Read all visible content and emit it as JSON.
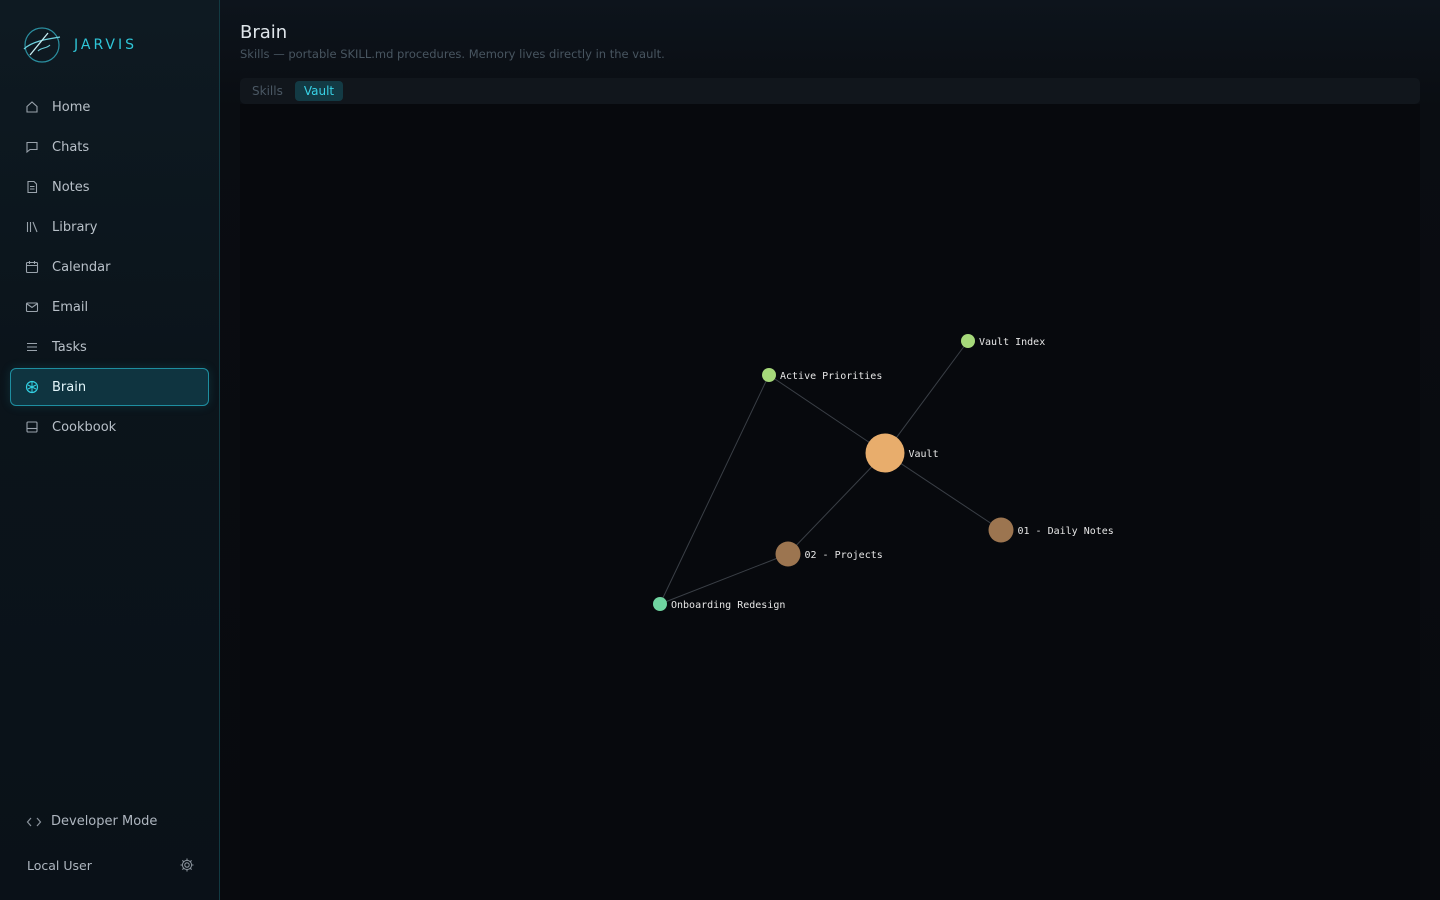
{
  "app": {
    "name": "JARVIS"
  },
  "sidebar": {
    "items": [
      {
        "label": "Home",
        "icon": "home-icon"
      },
      {
        "label": "Chats",
        "icon": "chat-icon"
      },
      {
        "label": "Notes",
        "icon": "note-icon"
      },
      {
        "label": "Library",
        "icon": "library-icon"
      },
      {
        "label": "Calendar",
        "icon": "calendar-icon"
      },
      {
        "label": "Email",
        "icon": "mail-icon"
      },
      {
        "label": "Tasks",
        "icon": "list-icon"
      },
      {
        "label": "Brain",
        "icon": "brain-icon",
        "active": true
      },
      {
        "label": "Cookbook",
        "icon": "book-icon"
      }
    ],
    "developer_mode": "Developer Mode",
    "user": "Local User"
  },
  "header": {
    "title": "Brain",
    "subtitle": "Skills — portable SKILL.md procedures. Memory lives directly in the vault."
  },
  "tabs": [
    {
      "label": "Skills",
      "active": false
    },
    {
      "label": "Vault",
      "active": true
    }
  ],
  "graph": {
    "nodes": [
      {
        "id": "vault",
        "label": "Vault",
        "color": "#e8ad6c",
        "size": "large"
      },
      {
        "id": "index",
        "label": "Vault Index",
        "color": "#a6d97a",
        "size": "small"
      },
      {
        "id": "active",
        "label": "Active Priorities",
        "color": "#a6d97a",
        "size": "small"
      },
      {
        "id": "daily",
        "label": "01 - Daily Notes",
        "color": "#9c7550",
        "size": "medium"
      },
      {
        "id": "projects",
        "label": "02 - Projects",
        "color": "#9c7550",
        "size": "medium"
      },
      {
        "id": "onboarding",
        "label": "Onboarding Redesign",
        "color": "#6fd4a0",
        "size": "small"
      }
    ],
    "edges": [
      [
        "vault",
        "index"
      ],
      [
        "vault",
        "active"
      ],
      [
        "vault",
        "daily"
      ],
      [
        "vault",
        "projects"
      ],
      [
        "active",
        "onboarding"
      ],
      [
        "projects",
        "onboarding"
      ]
    ],
    "edge_color": "#3a3f46"
  },
  "colors": {
    "accent": "#2fc6d8",
    "active_bg": "#0f3440",
    "active_border": "#1e8ea0"
  }
}
